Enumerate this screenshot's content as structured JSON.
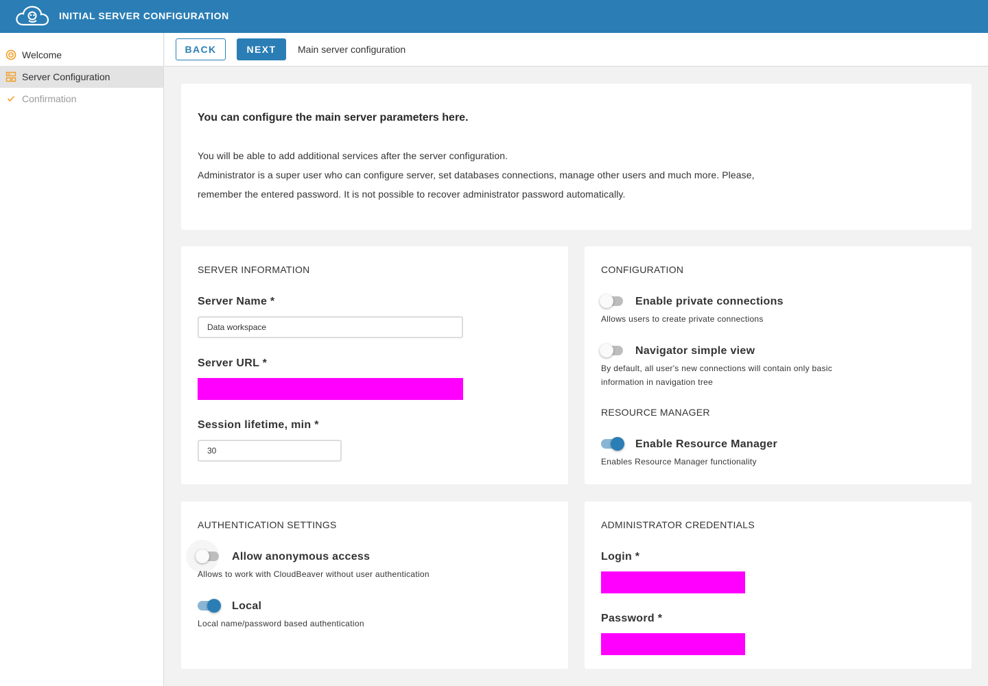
{
  "app": {
    "title": "INITIAL SERVER CONFIGURATION"
  },
  "colors": {
    "primary": "#2b7eb5",
    "accent": "#f39c1f",
    "redacted": "#ff00ff"
  },
  "sidebar": {
    "items": [
      {
        "label": "Welcome",
        "icon": "welcome-icon",
        "state": "done"
      },
      {
        "label": "Server Configuration",
        "icon": "server-config-icon",
        "state": "active"
      },
      {
        "label": "Confirmation",
        "icon": "check-icon",
        "state": "disabled"
      }
    ]
  },
  "toolbar": {
    "back_label": "BACK",
    "next_label": "NEXT",
    "step_caption": "Main server configuration"
  },
  "intro": {
    "heading": "You can configure the main server parameters here.",
    "line1": "You will be able to add additional services after the server configuration.",
    "line2": "Administrator is a super user who can configure server, set databases connections, manage other users and much more. Please,",
    "line3": "remember the entered password. It is not possible to recover administrator password automatically."
  },
  "server_info": {
    "title": "SERVER INFORMATION",
    "name_label": "Server Name *",
    "name_value": "Data workspace",
    "url_label": "Server URL *",
    "session_label": "Session lifetime, min *",
    "session_value": "30"
  },
  "configuration": {
    "title": "CONFIGURATION",
    "private": {
      "label": "Enable private connections",
      "desc": "Allows users to create private connections",
      "on": false
    },
    "navigator": {
      "label": "Navigator simple view",
      "desc_line1": "By default, all user's new connections will contain only basic",
      "desc_line2": "information in navigation tree",
      "on": false
    },
    "resource_title": "RESOURCE MANAGER",
    "resource": {
      "label": "Enable Resource Manager",
      "desc": "Enables Resource Manager functionality",
      "on": true
    }
  },
  "auth": {
    "title": "AUTHENTICATION SETTINGS",
    "anonymous": {
      "label": "Allow anonymous access",
      "desc": "Allows to work with CloudBeaver without user authentication",
      "on": false
    },
    "local": {
      "label": "Local",
      "desc": "Local name/password based authentication",
      "on": true
    }
  },
  "admin": {
    "title": "ADMINISTRATOR CREDENTIALS",
    "login_label": "Login *",
    "password_label": "Password *"
  }
}
